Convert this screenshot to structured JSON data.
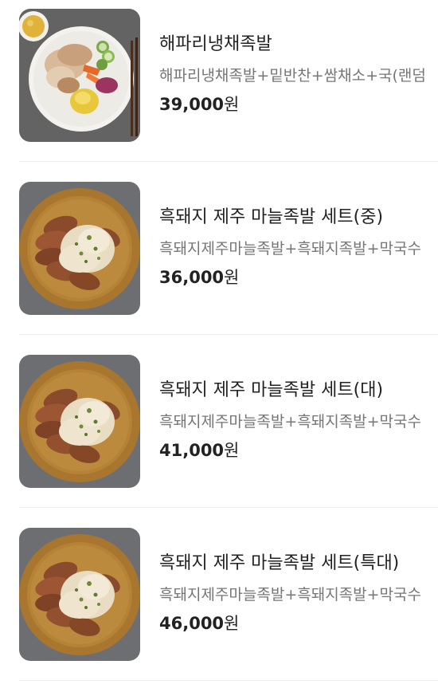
{
  "menu": {
    "items": [
      {
        "name": "해파리냉채족발",
        "description": "해파리냉채족발+밑반찬+쌈채소+국(랜덤",
        "price_amount": "39,000",
        "price_unit": "원",
        "image": "jellyfish-salad-jokbal-photo"
      },
      {
        "name": "흑돼지 제주 마늘족발 세트(중)",
        "description": "흑돼지제주마늘족발+흑돼지족발+막국수",
        "price_amount": "36,000",
        "price_unit": "원",
        "image": "garlic-jokbal-photo"
      },
      {
        "name": "흑돼지 제주 마늘족발 세트(대)",
        "description": "흑돼지제주마늘족발+흑돼지족발+막국수",
        "price_amount": "41,000",
        "price_unit": "원",
        "image": "garlic-jokbal-photo"
      },
      {
        "name": "흑돼지 제주 마늘족발 세트(특대)",
        "description": "흑돼지제주마늘족발+흑돼지족발+막국수",
        "price_amount": "46,000",
        "price_unit": "원",
        "image": "garlic-jokbal-photo"
      }
    ]
  },
  "colors": {
    "title_text": "#222222",
    "description_text": "#767676",
    "divider": "#eeeeee",
    "background": "#ffffff"
  }
}
